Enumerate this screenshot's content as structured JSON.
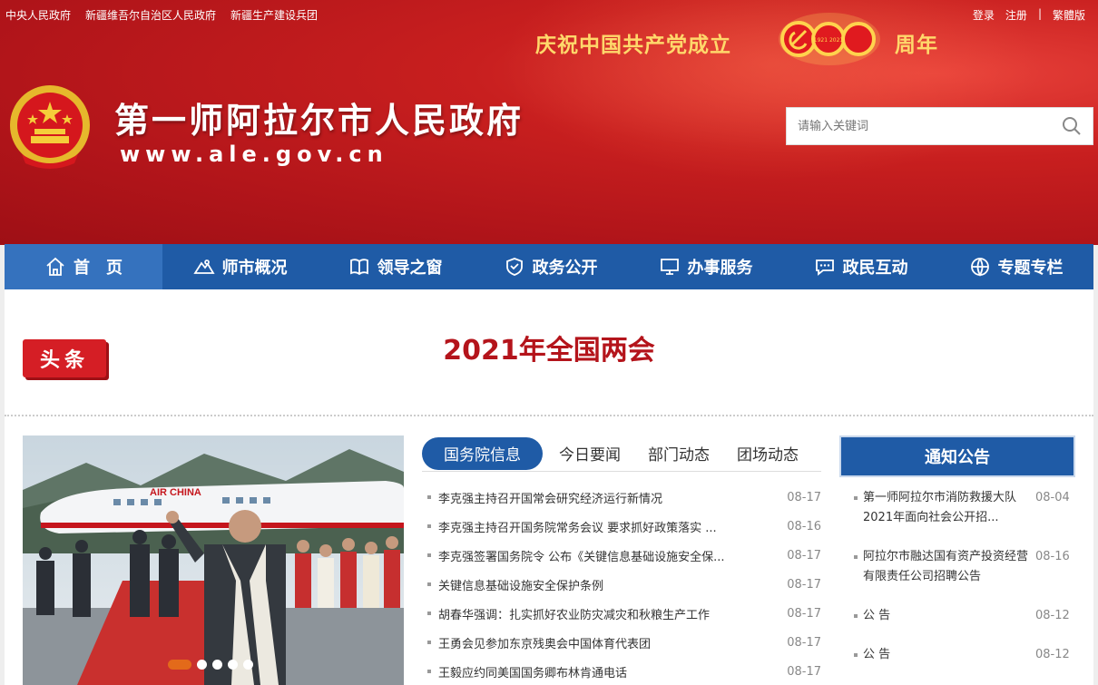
{
  "top_links": [
    "中央人民政府",
    "新疆维吾尔自治区人民政府",
    "新疆生产建设兵团"
  ],
  "user_links": {
    "login": "登录",
    "register": "注册",
    "divider": "|",
    "traditional": "繁體版"
  },
  "celebration": {
    "left": "庆祝中国共产党成立",
    "right": "周年",
    "years": "1921 2021"
  },
  "site": {
    "title": "第一师阿拉尔市人民政府",
    "url": "www.ale.gov.cn"
  },
  "search": {
    "placeholder": "请输入关键词"
  },
  "nav": [
    {
      "label": "首　页",
      "icon": "home-icon"
    },
    {
      "label": "师市概况",
      "icon": "mountain-icon"
    },
    {
      "label": "领导之窗",
      "icon": "book-icon"
    },
    {
      "label": "政务公开",
      "icon": "shield-icon"
    },
    {
      "label": "办事服务",
      "icon": "monitor-icon"
    },
    {
      "label": "政民互动",
      "icon": "chat-icon"
    },
    {
      "label": "专题专栏",
      "icon": "globe-icon"
    }
  ],
  "headline": {
    "badge": "头条",
    "title": "2021年全国两会"
  },
  "slider": {
    "plane_text": "AIR CHINA",
    "active_dot": 1,
    "dot_count": 5
  },
  "news_tabs": [
    "国务院信息",
    "今日要闻",
    "部门动态",
    "团场动态"
  ],
  "news": [
    {
      "title": "李克强主持召开国常会研究经济运行新情况",
      "date": "08-17"
    },
    {
      "title": "李克强主持召开国务院常务会议 要求抓好政策落实 ...",
      "date": "08-16"
    },
    {
      "title": "李克强签署国务院令 公布《关键信息基础设施安全保...",
      "date": "08-17"
    },
    {
      "title": "关键信息基础设施安全保护条例",
      "date": "08-17"
    },
    {
      "title": "胡春华强调：扎实抓好农业防灾减灾和秋粮生产工作",
      "date": "08-17"
    },
    {
      "title": "王勇会见参加东京残奥会中国体育代表团",
      "date": "08-17"
    },
    {
      "title": "王毅应约同美国国务卿布林肯通电话",
      "date": "08-17"
    }
  ],
  "notice": {
    "title": "通知公告",
    "items": [
      {
        "title": "第一师阿拉尔市消防救援大队2021年面向社会公开招...",
        "date": "08-04"
      },
      {
        "title": "阿拉尔市融达国有资产投资经营有限责任公司招聘公告",
        "date": "08-16"
      },
      {
        "title": "公 告",
        "date": "08-12"
      },
      {
        "title": "公 告",
        "date": "08-12"
      }
    ]
  },
  "colors": {
    "banner_red": "#c81f1f",
    "nav_blue": "#1f5ba6",
    "headline_red": "#b4141b",
    "gold": "#ffd86b"
  }
}
